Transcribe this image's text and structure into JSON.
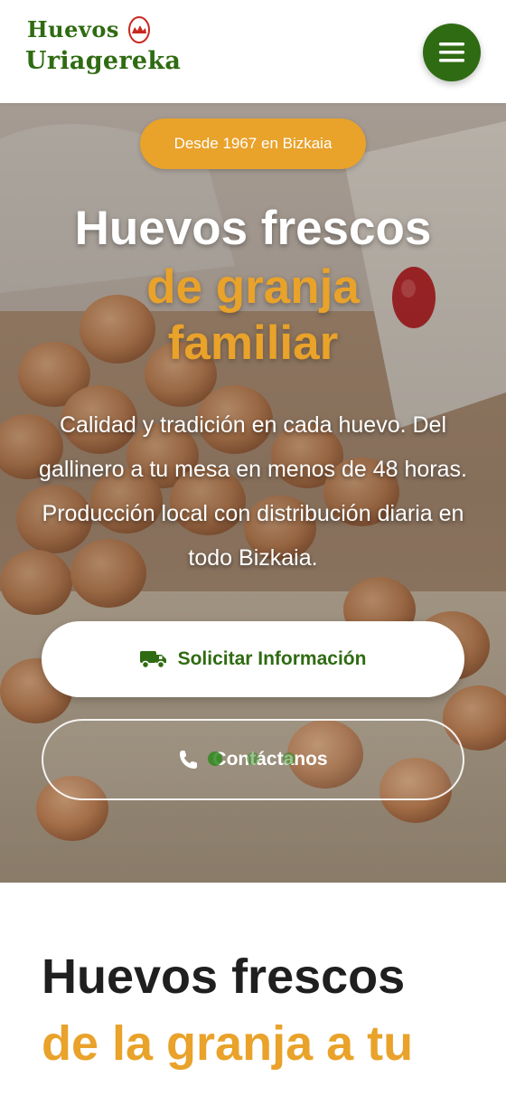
{
  "header": {
    "logo": {
      "line1": "Huevos",
      "line2": "Uriagereka"
    },
    "menu_icon": "hamburger-menu-icon"
  },
  "hero": {
    "badge": "Desde 1967 en Bizkaia",
    "title": "Huevos frescos",
    "title_accent_line1": "de granja",
    "title_accent_line2": "familiar",
    "description": "Calidad y tradición en cada huevo. Del gallinero a tu mesa en menos de 48 horas. Producción local con distribución diaria en todo Bizkaia.",
    "primary_button": {
      "label": "Solicitar Información",
      "icon": "truck-icon"
    },
    "secondary_button": {
      "label": "Contáctanos",
      "icon": "phone-icon"
    }
  },
  "section": {
    "title": "Huevos frescos",
    "title_accent": "de la granja a tu mesa"
  },
  "colors": {
    "brand_green": "#2f6b12",
    "accent_orange": "#e9a22a",
    "white": "#ffffff",
    "text_dark": "#1f1f1f"
  }
}
